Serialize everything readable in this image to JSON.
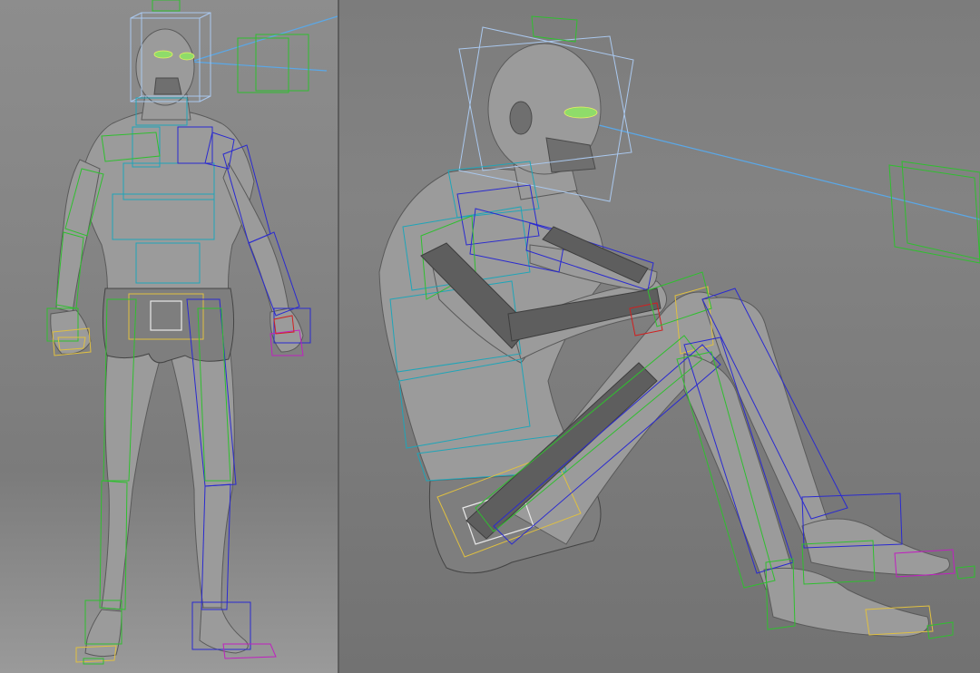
{
  "viewports": [
    {
      "id": "left",
      "view": "front",
      "pose": "standing"
    },
    {
      "id": "right",
      "view": "perspective",
      "pose": "seated"
    }
  ],
  "colors": {
    "background": "#7a7a7a",
    "skin": "#9b9b9b",
    "control_blue": "#2a2ad0",
    "control_green": "#2fbf2f",
    "control_cyan": "#1fa5b8",
    "control_light_blue": "#aac8ee",
    "control_yellow": "#e0c040",
    "control_magenta": "#c020c0",
    "gaze_line": "#5aa8e8"
  }
}
